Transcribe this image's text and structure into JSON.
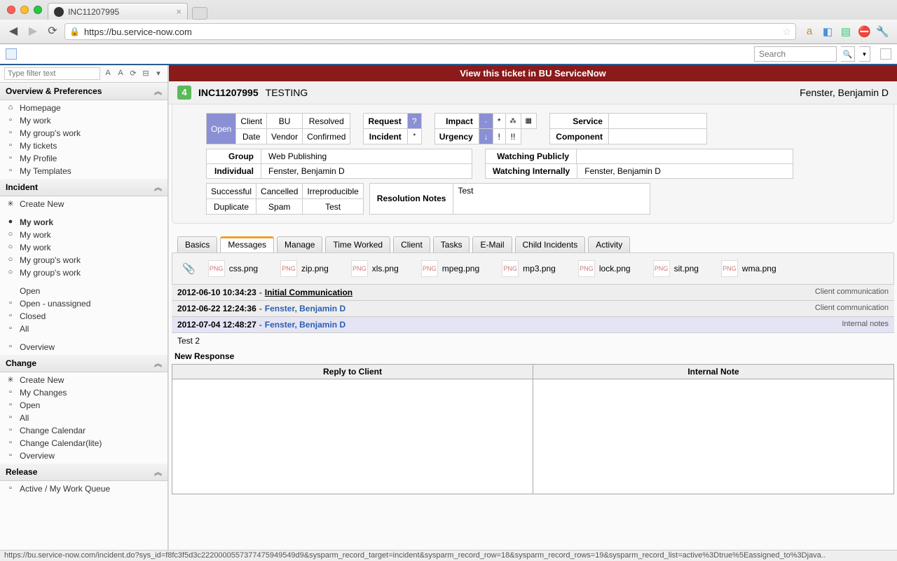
{
  "browser": {
    "tab_title": "INC11207995",
    "url": "https://bu.service-now.com"
  },
  "topbar": {
    "search_placeholder": "Search"
  },
  "sidebar": {
    "filter_placeholder": "Type filter text",
    "sections": {
      "overview": "Overview & Preferences",
      "incident": "Incident",
      "change": "Change",
      "release": "Release"
    },
    "overview_items": [
      "Homepage",
      "My work",
      "My group's work",
      "My tickets",
      "My Profile",
      "My Templates"
    ],
    "incident_items": [
      "Create New",
      "My work",
      "My work",
      "My work",
      "My group's work",
      "My group's work",
      "Open",
      "Open - unassigned",
      "Closed",
      "All",
      "Overview"
    ],
    "change_items": [
      "Create New",
      "My Changes",
      "Open",
      "All",
      "Change Calendar",
      "Change Calendar(lite)",
      "Overview"
    ],
    "release_items": [
      "Active / My Work Queue"
    ]
  },
  "banner": "View this ticket in BU ServiceNow",
  "ticket": {
    "priority": "4",
    "number": "INC11207995",
    "title": "TESTING",
    "user": "Fenster, Benjamin D"
  },
  "form": {
    "open": "Open",
    "grid1": {
      "client": "Client",
      "bu": "BU",
      "resolved": "Resolved",
      "date": "Date",
      "vendor": "Vendor",
      "confirmed": "Confirmed"
    },
    "grid2": {
      "request": "Request",
      "incident": "Incident",
      "q": "?",
      "star": "*"
    },
    "grid3": {
      "impact": "Impact",
      "urgency": "Urgency",
      "star": "*",
      "tree": "⁂",
      "grid": "▦",
      "arr": "↓",
      "bang1": "!",
      "bang2": "!!"
    },
    "grid4": {
      "service": "Service",
      "component": "Component"
    },
    "group_lbl": "Group",
    "group_val": "Web Publishing",
    "individual_lbl": "Individual",
    "individual_val": "Fenster, Benjamin D",
    "wpub_lbl": "Watching Publicly",
    "wpub_val": "",
    "wint_lbl": "Watching Internally",
    "wint_val": "Fenster, Benjamin D",
    "res_choices": {
      "successful": "Successful",
      "cancelled": "Cancelled",
      "irreproducible": "Irreproducible",
      "duplicate": "Duplicate",
      "spam": "Spam",
      "test": "Test"
    },
    "res_notes_lbl": "Resolution Notes",
    "res_notes_val": "Test"
  },
  "tabs": [
    "Basics",
    "Messages",
    "Manage",
    "Time Worked",
    "Client",
    "Tasks",
    "E-Mail",
    "Child Incidents",
    "Activity"
  ],
  "active_tab": 1,
  "attachments": [
    "css.png",
    "zip.png",
    "xls.png",
    "mpeg.png",
    "mp3.png",
    "lock.png",
    "sit.png",
    "wma.png"
  ],
  "log": [
    {
      "time": "2012-06-10 10:34:23",
      "who": "Initial Communication",
      "type": "Client communication",
      "style": "u"
    },
    {
      "time": "2012-06-22 12:24:36",
      "who": "Fenster, Benjamin D",
      "type": "Client communication",
      "style": "link"
    },
    {
      "time": "2012-07-04 12:48:27",
      "who": "Fenster, Benjamin D",
      "type": "Internal notes",
      "style": "link",
      "internal": true,
      "body": "Test 2"
    }
  ],
  "new_response": "New Response",
  "reply_header": "Reply to Client",
  "internal_header": "Internal Note",
  "statusbar": "https://bu.service-now.com/incident.do?sys_id=f8fc3f5d3c2220000557377475949549d9&sysparm_record_target=incident&sysparm_record_row=18&sysparm_record_rows=19&sysparm_record_list=active%3Dtrue%5Eassigned_to%3Djava.."
}
